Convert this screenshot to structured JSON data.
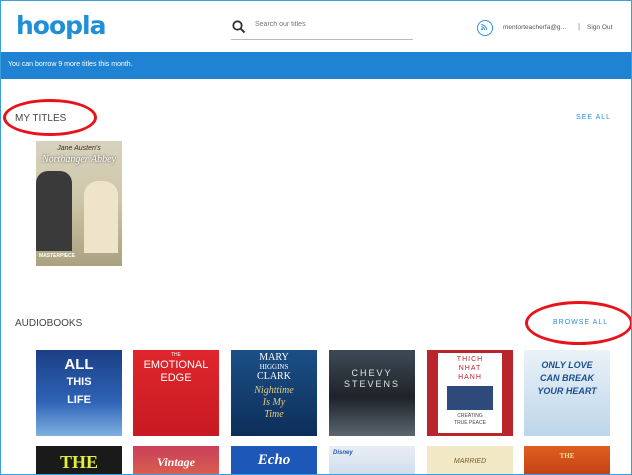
{
  "header": {
    "logo": "hoopla",
    "search_placeholder": "Search our titles",
    "username": "mentorteacherfa@g...",
    "separator": "|",
    "signout": "Sign Out"
  },
  "banner": {
    "text": "You can borrow 9 more titles this month."
  },
  "my_titles": {
    "title": "MY TITLES",
    "see_all": "SEE ALL",
    "items": [
      {
        "author": "Jane Austen's",
        "title": "Northanger Abbey",
        "footer": "MASTERPIECE"
      }
    ]
  },
  "audiobooks": {
    "title": "AUDIOBOOKS",
    "browse_all": "BROWSE ALL",
    "row1": [
      {
        "lines": [
          "ALL",
          "THIS",
          "LIFE"
        ]
      },
      {
        "lines": [
          "THE",
          "EMOTIONAL",
          "EDGE"
        ]
      },
      {
        "lines": [
          "MARY",
          "HIGGINS",
          "CLARK",
          "Nighttime",
          "Is My",
          "Time"
        ]
      },
      {
        "lines": [
          "CHEVY",
          "STEVENS"
        ]
      },
      {
        "lines": [
          "THICH",
          "NHAT",
          "HANH",
          "CREATING",
          "TRUE PEACE"
        ]
      },
      {
        "lines": [
          "ONLY LOVE",
          "CAN BREAK",
          "YOUR HEART"
        ]
      }
    ],
    "row2": [
      {
        "lines": [
          "THE"
        ]
      },
      {
        "lines": [
          "Vintage"
        ]
      },
      {
        "lines": [
          "Echo"
        ]
      },
      {
        "lines": [
          "Disney"
        ]
      },
      {
        "lines": [
          "MARRIED"
        ]
      },
      {
        "lines": [
          "THE"
        ]
      }
    ]
  }
}
